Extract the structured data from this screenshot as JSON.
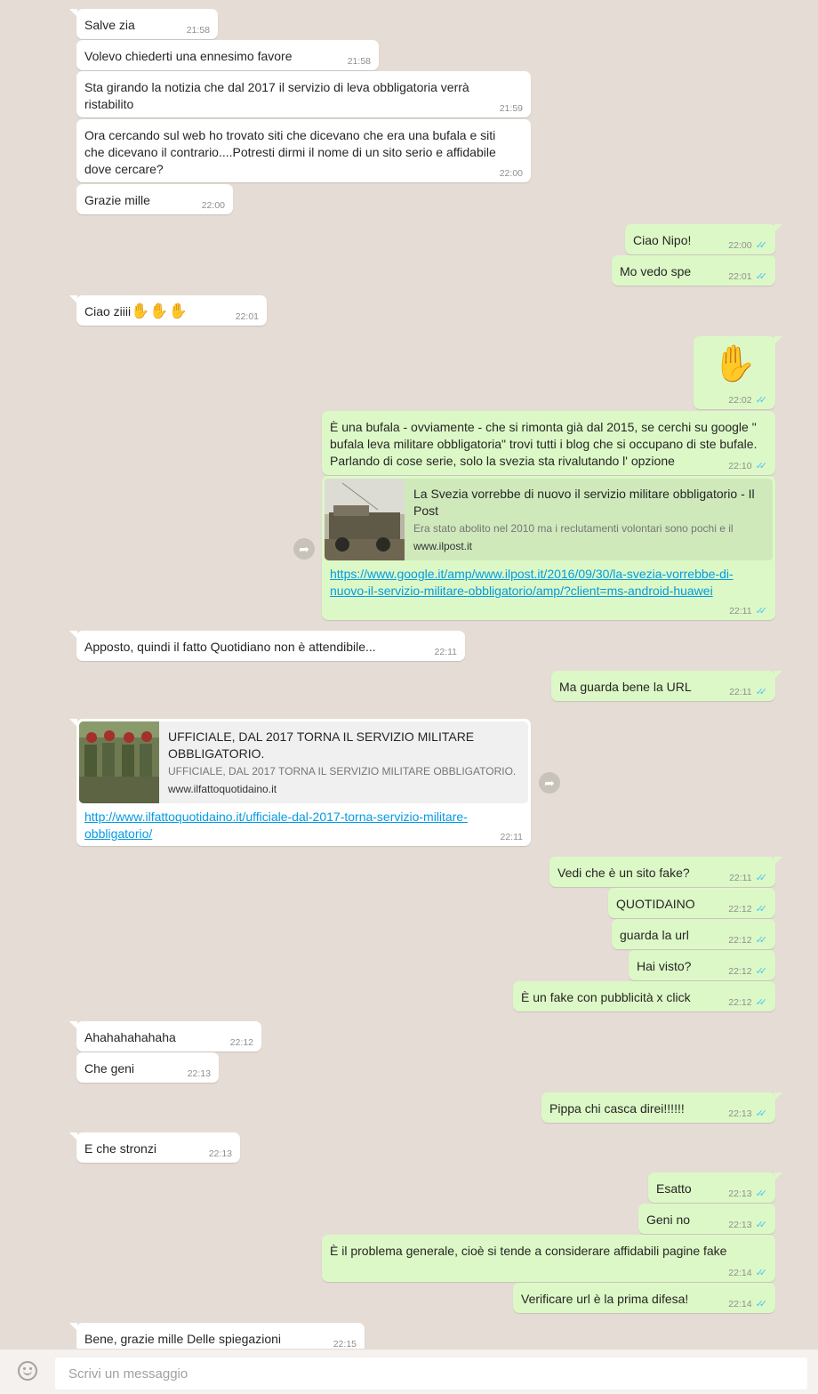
{
  "messages": [
    {
      "text": "Salve zia",
      "time": "21:58"
    },
    {
      "text": "Volevo chiederti una ennesimo favore",
      "time": "21:58"
    },
    {
      "text": "Sta girando la notizia che dal 2017 il servizio di leva obbligatoria verrà ristabilito",
      "time": "21:59"
    },
    {
      "text": "Ora cercando sul web ho trovato siti che dicevano che era una bufala e siti che dicevano il contrario....Potresti dirmi il nome di un sito serio e affidabile dove cercare?",
      "time": "22:00"
    },
    {
      "text": "Grazie mille",
      "time": "22:00"
    },
    {
      "text": "Ciao Nipo!",
      "time": "22:00"
    },
    {
      "text": "Mo vedo spe",
      "time": "22:01"
    },
    {
      "text": "Ciao ziiii",
      "emoji": "✋✋✋",
      "time": "22:01"
    },
    {
      "emoji": "✋",
      "time": "22:02"
    },
    {
      "text": "È una bufala - ovviamente - che si rimonta già dal 2015, se cerchi su google \" bufala leva militare obbligatoria\" trovi tutti i blog che si occupano di ste bufale. Parlando di cose serie, solo la svezia sta rivalutando l' opzione",
      "time": "22:10"
    },
    {
      "preview_title": "La Svezia vorrebbe di nuovo il servizio militare obbligatorio - Il Post",
      "preview_desc": "Era stato abolito nel 2010 ma i reclutamenti volontari sono pochi e il",
      "preview_site": "www.ilpost.it",
      "link": "https://www.google.it/amp/www.ilpost.it/2016/09/30/la-svezia-vorrebbe-di-nuovo-il-servizio-militare-obbligatorio/amp/?client=ms-android-huawei",
      "time": "22:11"
    },
    {
      "text": "Apposto, quindi il fatto Quotidiano non è attendibile...",
      "time": "22:11"
    },
    {
      "text": "Ma guarda bene la URL",
      "time": "22:11"
    },
    {
      "preview_title": "UFFICIALE, DAL 2017 TORNA IL SERVIZIO MILITARE OBBLIGATORIO.",
      "preview_desc": "UFFICIALE, DAL 2017 TORNA IL SERVIZIO MILITARE OBBLIGATORIO.",
      "preview_site": "www.ilfattoquotidaino.it",
      "link": "http://www.ilfattoquotidaino.it/ufficiale-dal-2017-torna-servizio-militare-obbligatorio/",
      "time": "22:11"
    },
    {
      "text": "Vedi che è un sito fake?",
      "time": "22:11"
    },
    {
      "text": "QUOTIDAINO",
      "time": "22:12"
    },
    {
      "text": "guarda la url",
      "time": "22:12"
    },
    {
      "text": "Hai visto?",
      "time": "22:12"
    },
    {
      "text": "È un fake con pubblicità x click",
      "time": "22:12"
    },
    {
      "text": "Ahahahahahaha",
      "time": "22:12"
    },
    {
      "text": "Che geni",
      "time": "22:13"
    },
    {
      "text": "Pippa chi casca direi!!!!!!",
      "time": "22:13"
    },
    {
      "text": "E che stronzi",
      "time": "22:13"
    },
    {
      "text": "Esatto",
      "time": "22:13"
    },
    {
      "text": "Geni no",
      "time": "22:13"
    },
    {
      "text": "È il problema generale, cioè si tende a considerare affidabili pagine fake",
      "time": "22:14"
    },
    {
      "text": "Verificare url è la prima difesa!",
      "time": "22:14"
    },
    {
      "text": "Bene, grazie mille Delle spiegazioni",
      "time": "22:15"
    }
  ],
  "read_ticks": "✓✓",
  "forward_icon": "➦",
  "composer": {
    "placeholder": "Scrivi un messaggio",
    "emoji_icon": "smiley-icon"
  },
  "colors": {
    "background": "#e5ddd5",
    "incoming": "#ffffff",
    "outgoing": "#dcf8c6",
    "link": "#039be5",
    "read_ticks": "#4fc3f7"
  }
}
